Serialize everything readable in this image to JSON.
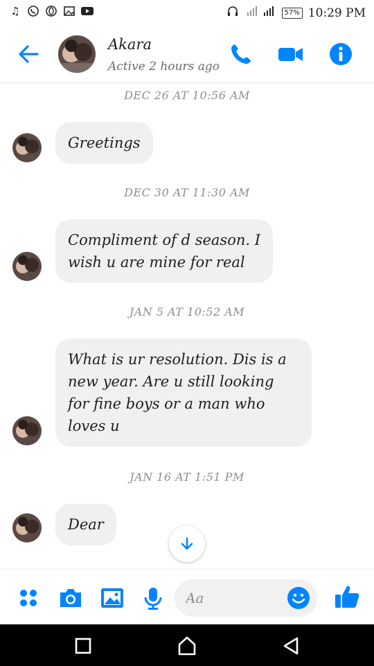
{
  "status_bar": {
    "battery": "57%",
    "time": "10:29 PM",
    "left_icons": [
      "music-icon",
      "whatsapp-icon",
      "opera-icon",
      "gallery-icon",
      "youtube-icon"
    ],
    "right_icons": [
      "headset-icon",
      "signal-icon"
    ]
  },
  "header": {
    "name": "Akara",
    "status": "Active 2 hours ago",
    "accent": "#0084ff"
  },
  "messages": [
    {
      "timestamp": "DEC 26 AT 10:56 AM",
      "lines": [
        "Greetings"
      ]
    },
    {
      "timestamp": "DEC 30 AT 11:30 AM",
      "lines": [
        "Compliment of d season. I",
        "wish u are mine for real"
      ]
    },
    {
      "timestamp": "JAN 5 AT 10:52 AM",
      "lines": [
        "What is ur resolution.  Dis is a",
        "new year. Are u still looking",
        "for fine boys or a man who",
        "loves u"
      ]
    },
    {
      "timestamp": "JAN 16 AT 1:51 PM",
      "lines": [
        "Dear"
      ]
    }
  ],
  "composer": {
    "placeholder": "Aa"
  },
  "colors": {
    "bubble": "#f0f0f0",
    "accent": "#0084ff",
    "timestamp": "#8a8d91"
  }
}
